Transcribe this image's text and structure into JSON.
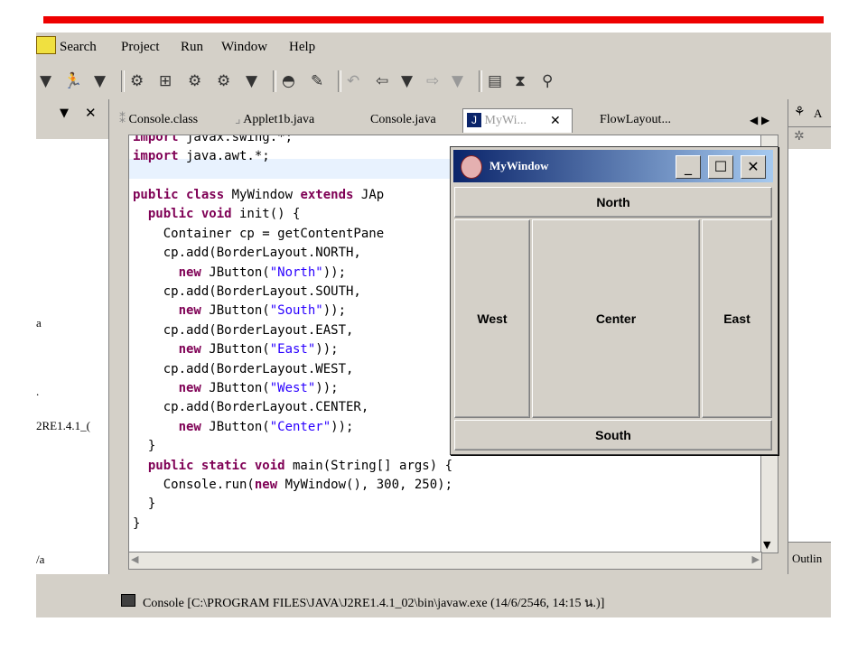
{
  "menu": {
    "items": [
      "Search",
      "Project",
      "Run",
      "Window",
      "Help"
    ]
  },
  "left_panel": {
    "fragments": [
      "a",
      ".",
      "2RE1.4.1_(",
      "/a"
    ]
  },
  "tabs": [
    {
      "label": "Console.class"
    },
    {
      "label": "Applet1b.java"
    },
    {
      "label": "Console.java"
    },
    {
      "label": "MyWi..."
    },
    {
      "label": "FlowLayout..."
    }
  ],
  "code": {
    "line0": "import javax.swing.*;",
    "line1": "import java.awt.*;",
    "line3a": "public class",
    "line3b": " MyWindow ",
    "line3c": "extends",
    "line3d": " JAp",
    "line4a": "  public void",
    "line4b": " init() {",
    "line5": "    Container cp = getContentPane",
    "line6": "    cp.add(BorderLayout.NORTH,",
    "line7a": "      new",
    "line7b": " JButton(",
    "line7c": "\"North\"",
    "line7d": "));",
    "line8": "    cp.add(BorderLayout.SOUTH,",
    "line9c": "\"South\"",
    "line10": "    cp.add(BorderLayout.EAST,",
    "line11c": "\"East\"",
    "line12": "    cp.add(BorderLayout.WEST,",
    "line13c": "\"West\"",
    "line14": "    cp.add(BorderLayout.CENTER,",
    "line15c": "\"Center\"",
    "line16": "  }",
    "line17a": "  public static void",
    "line17b": " main(String[] args) {",
    "line18a": "    Console.run(",
    "line18b": "new",
    "line18c": " MyWindow(), 300, 250);",
    "line19": "  }",
    "line20": "}"
  },
  "right_panel": {
    "label1": "A",
    "outline": "Outlin"
  },
  "console": {
    "text": "Console [C:\\PROGRAM FILES\\JAVA\\J2RE1.4.1_02\\bin\\javaw.exe (14/6/2546, 14:15 น.)]"
  },
  "mywindow": {
    "title": "MyWindow",
    "north": "North",
    "south": "South",
    "east": "East",
    "west": "West",
    "center": "Center"
  }
}
